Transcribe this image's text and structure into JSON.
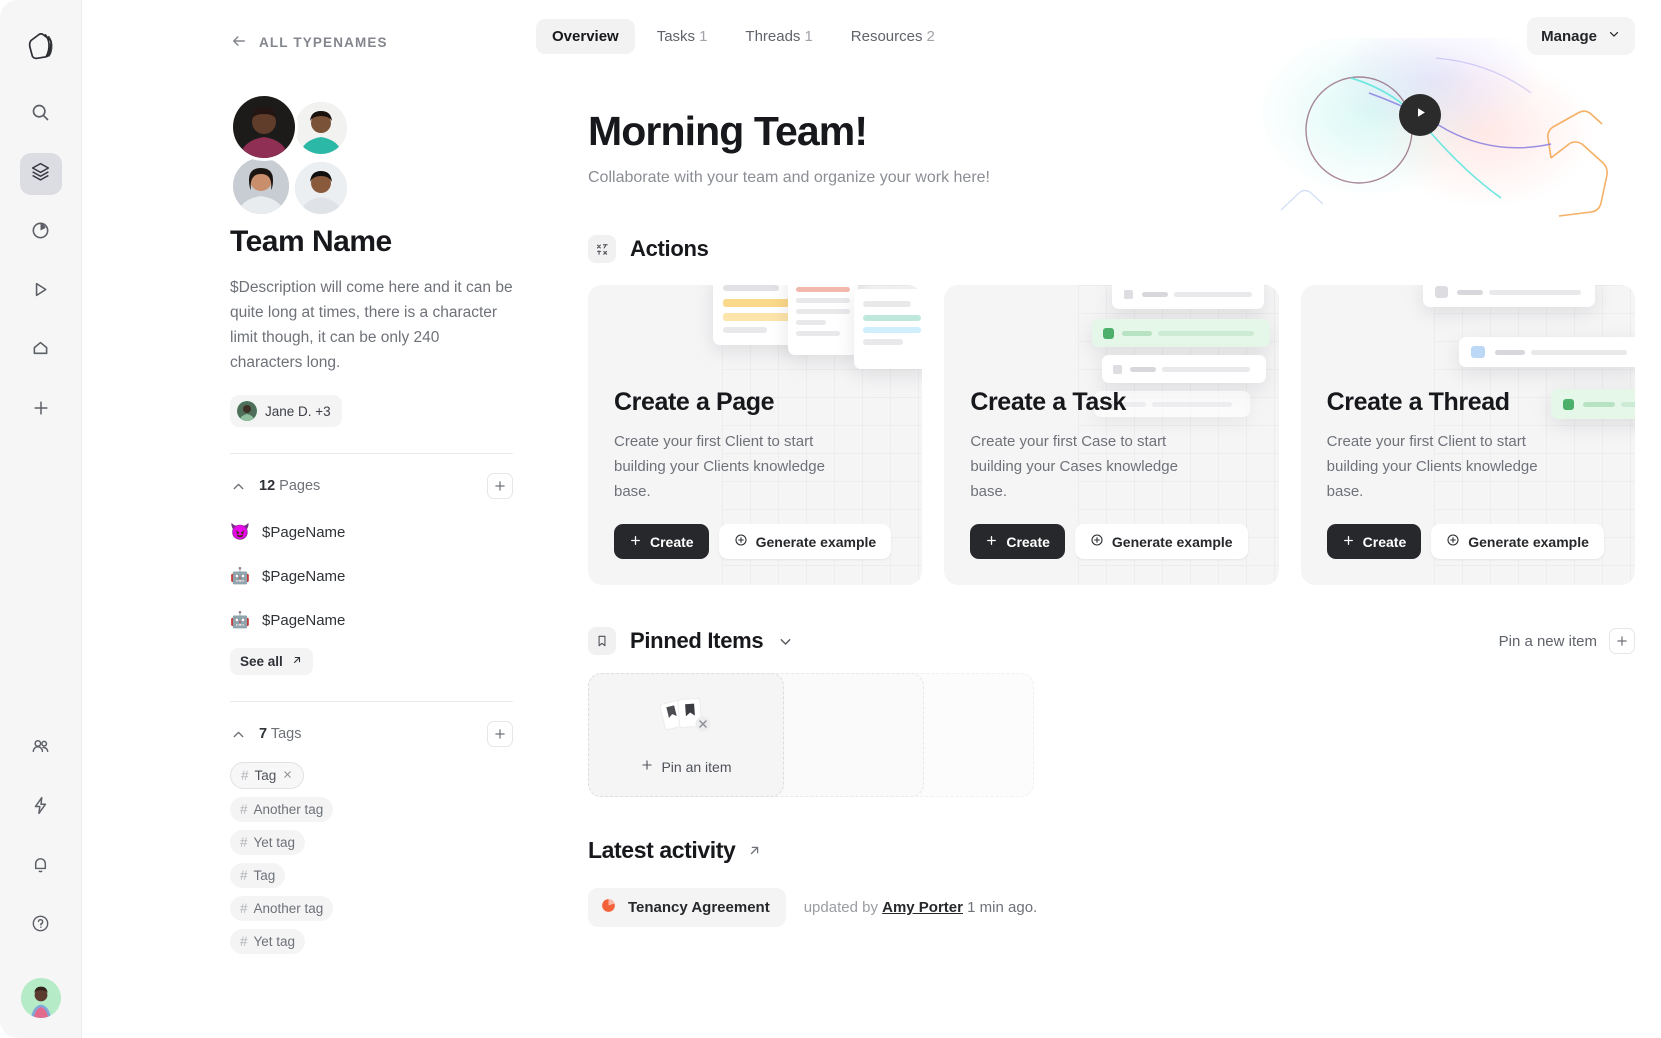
{
  "rail": {
    "logo_icon": "cube-logo-icon",
    "items": [
      {
        "icon": "search-icon",
        "name": "search",
        "active": false
      },
      {
        "icon": "layers-icon",
        "name": "layers",
        "active": true
      },
      {
        "icon": "pie-chart-icon",
        "name": "analytics",
        "active": false
      },
      {
        "icon": "play-triangle-icon",
        "name": "play",
        "active": false
      },
      {
        "icon": "home-icon",
        "name": "home",
        "active": false
      },
      {
        "icon": "plus-icon",
        "name": "add",
        "active": false
      }
    ],
    "bottom_items": [
      {
        "icon": "people-icon",
        "name": "people"
      },
      {
        "icon": "lightning-icon",
        "name": "automations"
      },
      {
        "icon": "bell-icon",
        "name": "notifications"
      },
      {
        "icon": "help-circle-icon",
        "name": "help"
      }
    ],
    "avatar_alt": "user-avatar"
  },
  "sidebar": {
    "back_label": "ALL TYPENAMES",
    "team_name": "Team Name",
    "team_description": "$Description will come here and it can be quite long at times, there is a character limit though, it can be only 240 characters long.",
    "members_label": "Jane D. +3",
    "pages_section": {
      "count": "12",
      "label": "Pages",
      "add_tooltip": "Add page",
      "items": [
        {
          "emoji": "😈",
          "label": "$PageName"
        },
        {
          "emoji": "🤖",
          "label": "$PageName"
        },
        {
          "emoji": "🤖",
          "label": "$PageName"
        }
      ],
      "see_all_label": "See all"
    },
    "tags_section": {
      "count": "7",
      "label": "Tags",
      "items": [
        {
          "label": "Tag",
          "selected": true
        },
        {
          "label": "Another tag",
          "selected": false
        },
        {
          "label": "Yet tag",
          "selected": false
        },
        {
          "label": "Tag",
          "selected": false
        },
        {
          "label": "Another tag",
          "selected": false
        },
        {
          "label": "Yet tag",
          "selected": false
        }
      ]
    }
  },
  "topbar": {
    "tabs": [
      {
        "label": "Overview",
        "count": "",
        "active": true
      },
      {
        "label": "Tasks",
        "count": "1",
        "active": false
      },
      {
        "label": "Threads",
        "count": "1",
        "active": false
      },
      {
        "label": "Resources",
        "count": "2",
        "active": false
      }
    ],
    "manage_label": "Manage"
  },
  "hero": {
    "title": "Morning Team!",
    "subtitle": "Collaborate with your team and organize your work here!",
    "play_icon": "play-icon"
  },
  "actions": {
    "section_title": "Actions",
    "section_icon": "actions-icon",
    "cards": [
      {
        "title": "Create a Page",
        "description": "Create your first Client to start building your Clients knowledge base.",
        "primary_label": "Create",
        "secondary_label": "Generate example"
      },
      {
        "title": "Create a Task",
        "description": "Create your first Case to start building your Cases knowledge base.",
        "primary_label": "Create",
        "secondary_label": "Generate example"
      },
      {
        "title": "Create a Thread",
        "description": "Create your first Client to start building your Clients knowledge base.",
        "primary_label": "Create",
        "secondary_label": "Generate example"
      }
    ]
  },
  "pinned": {
    "section_title": "Pinned Items",
    "section_icon": "bookmark-icon",
    "chevron_icon": "chevron-down-icon",
    "pin_new_label": "Pin a new item",
    "empty_cta": "Pin an item"
  },
  "activity": {
    "title": "Latest activity",
    "link_icon": "arrow-up-right-icon",
    "item_label": "Tenancy Agreement",
    "item_icon": "pie-doc-icon",
    "updated_prefix": "updated by",
    "user": "Amy Porter",
    "time": "1 min ago."
  },
  "colors": {
    "accent_dark": "#26282b",
    "rail_bg": "#f6f6f7",
    "card_bg": "#f5f5f6",
    "activity_icon": "#f4623a",
    "active_rail": "#dcdde3"
  }
}
